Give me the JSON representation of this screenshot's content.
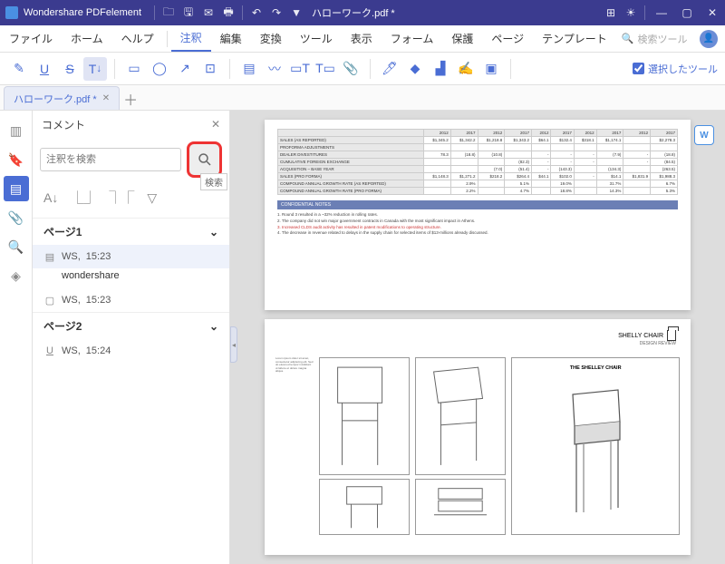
{
  "titlebar": {
    "app_name": "Wondershare PDFelement",
    "doc_name": "ハローワーク.pdf *",
    "dropdown": "▼"
  },
  "menubar": {
    "items": [
      "ファイル",
      "ホーム",
      "ヘルプ",
      "注釈",
      "編集",
      "変換",
      "ツール",
      "表示",
      "フォーム",
      "保護",
      "ページ",
      "テンプレート"
    ],
    "active_index": 3,
    "search_placeholder": "検索ツール"
  },
  "toolbar": {
    "selected_label": "選択したツール"
  },
  "tabbar": {
    "tab_label": "ハローワーク.pdf *"
  },
  "sidepanel": {
    "title": "コメント",
    "search_placeholder": "注釈を検索",
    "search_tooltip": "検索",
    "pages": [
      {
        "label": "ページ1",
        "items": [
          {
            "author": "WS,",
            "time": "15:23",
            "icon": "note",
            "selected": true,
            "text": "wondershare"
          },
          {
            "author": "WS,",
            "time": "15:23",
            "icon": "box"
          }
        ]
      },
      {
        "label": "ページ2",
        "items": [
          {
            "author": "WS,",
            "time": "15:24",
            "icon": "underline"
          }
        ]
      }
    ]
  },
  "doc": {
    "word_badge": "W",
    "table": {
      "years": [
        "2012",
        "2017",
        "2012",
        "2017",
        "2012",
        "2017",
        "2012",
        "2017",
        "2012",
        "2017"
      ],
      "rows": [
        {
          "label": "SALES (AS REPORTED)",
          "vals": [
            "$1,345.2",
            "$1,342.2",
            "$1,218.8",
            "$1,343.2",
            "$64.1",
            "$132.4",
            "$318.1",
            "$1,174.1",
            "",
            "$2,278.3"
          ]
        },
        {
          "label": "PROFORMA ADJUSTMENTS",
          "vals": [
            "",
            "",
            "",
            "",
            "",
            "",
            "",
            "",
            "",
            ""
          ]
        },
        {
          "label": "DEALER DIVESTITURES",
          "vals": [
            "78.3",
            "(18.8)",
            "(10.8)",
            "",
            "-",
            "-",
            "-",
            "(7.9)",
            "-",
            "(18.8)"
          ]
        },
        {
          "label": "CUMULATIVE FOREIGN EXCHANGE",
          "vals": [
            "",
            "",
            "",
            "(82.3)",
            "-",
            "-",
            "-",
            "",
            "-",
            "(84.5)"
          ]
        },
        {
          "label": "ACQUISITION – BASE YEAR",
          "vals": [
            "",
            "",
            "(7.0)",
            "(51.4)",
            "-",
            "(143.3)",
            "",
            "(134.3)",
            "",
            "(263.5)"
          ]
        },
        {
          "label": "SALES (PRO FORMA)",
          "vals": [
            "$1,148.3",
            "$1,271.2",
            "$218.2",
            "$264.4",
            "$44.1",
            "$102.0",
            "-",
            "$14.1",
            "$1,831.9",
            "$1,988.3"
          ]
        },
        {
          "label": "COMPOUND ANNUAL GROWTH RATE (AS REPORTED)",
          "vals": [
            "",
            "2.9%",
            "",
            "5.1%",
            "",
            "19.0%",
            "",
            "31.7%",
            "",
            "6.7%"
          ]
        },
        {
          "label": "COMPOUND ANNUAL GROWTH RATE (PRO FORMA)",
          "vals": [
            "",
            "2.2%",
            "",
            "4.7%",
            "",
            "18.8%",
            "",
            "14.3%",
            "",
            "5.3%"
          ]
        }
      ]
    },
    "conf_title": "CONFIDENTIAL NOTES",
    "notes": [
      "1. Round 3 resulted in a ~32% reduction in rolling rates.",
      "2. The company did not win major government contracts in Canada with the most significant impact in Athens.",
      "3. Increased CLDS audit activity has resulted in patent modifications to operating structure.",
      "4. The decrease in revenue related to delays in the supply chain for selected items of $13-millions already discussed."
    ],
    "page2": {
      "title": "SHELLY CHAIR",
      "subtitle": "DESIGN REVIEW",
      "card_title": "THE SHELLEY CHAIR"
    }
  }
}
